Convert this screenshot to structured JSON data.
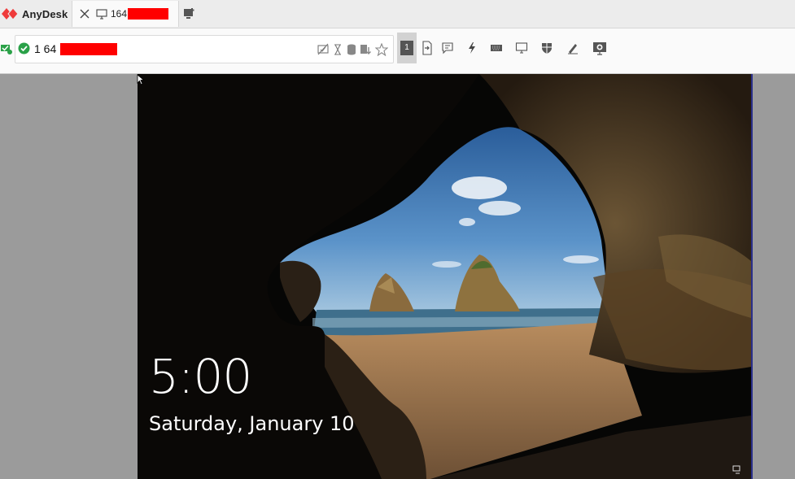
{
  "app": {
    "brand": "AnyDesk",
    "colors": {
      "brand": "#ef3b3b",
      "redaction": "#ff0000",
      "ok": "#2aa148"
    }
  },
  "tab": {
    "icon": "monitor-icon",
    "label": "164",
    "close_icon": "close-icon"
  },
  "toolbar": {
    "address_prefix": "1 64",
    "status_icon": "check-circle-icon",
    "address_icons": [
      "privacy-icon",
      "hourglass-icon",
      "database-icon",
      "download-icon",
      "favorite-star-icon"
    ],
    "actions": [
      "monitor-select-button",
      "file-transfer-icon",
      "chat-icon",
      "actions-lightning-icon",
      "keyboard-icon",
      "display-icon",
      "permissions-shield-icon",
      "whiteboard-pen-icon",
      "record-icon"
    ],
    "monitor_number": "1"
  },
  "remote": {
    "time": "5:00",
    "date": "Saturday, January 10"
  }
}
